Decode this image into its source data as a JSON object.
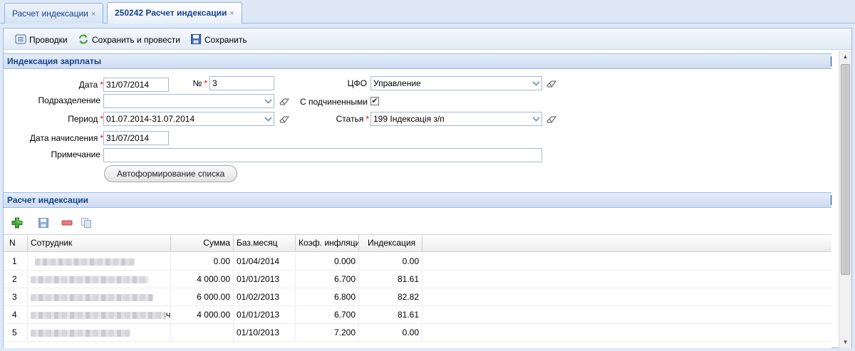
{
  "tabs": [
    {
      "label": "Расчет индексации",
      "close": "×"
    },
    {
      "label": "250242 Расчет индексации",
      "close": "×"
    }
  ],
  "toolbar": {
    "entries_label": "Проводки",
    "save_and_post_label": "Сохранить и провести",
    "save_label": "Сохранить"
  },
  "form": {
    "section_title": "Индексация зарплаты",
    "date": {
      "label": "Дата",
      "value": "31/07/2014"
    },
    "number": {
      "label": "№",
      "value": "3"
    },
    "cfo": {
      "label": "ЦФО",
      "value": "Управление"
    },
    "department": {
      "label": "Подразделение",
      "value": ""
    },
    "with_subordinates": {
      "label": "С подчиненными",
      "checked": true,
      "mark": "✔"
    },
    "period": {
      "label": "Период",
      "value": "01.07.2014-31.07.2014"
    },
    "article": {
      "label": "Статья",
      "value": "199 Індексація з/п"
    },
    "accrual_date": {
      "label": "Дата начисления",
      "value": "31/07/2014"
    },
    "note": {
      "label": "Примечание",
      "value": ""
    },
    "autofill_button": "Автоформирование списка",
    "required_mark": "*"
  },
  "grid": {
    "section_title": "Расчет индексации",
    "columns": [
      "N",
      "Сотрудник",
      "Сумма",
      "Баз.месяц",
      "Коэф. инфляции",
      "Индексация"
    ],
    "rows": [
      {
        "n": "1",
        "employee_tail": "",
        "sum": "0.00",
        "base_month": "01/04/2014",
        "coef": "0.000",
        "indexation": "0.00"
      },
      {
        "n": "2",
        "employee_tail": "",
        "sum": "4 000.00",
        "base_month": "01/01/2013",
        "coef": "6.700",
        "indexation": "81.61"
      },
      {
        "n": "3",
        "employee_tail": "",
        "sum": "6 000.00",
        "base_month": "01/02/2013",
        "coef": "6.800",
        "indexation": "82.82"
      },
      {
        "n": "4",
        "employee_tail": "ч",
        "sum": "4 000.00",
        "base_month": "01/01/2013",
        "coef": "6.700",
        "indexation": "81.61"
      },
      {
        "n": "5",
        "employee_tail": "",
        "sum": "",
        "base_month": "01/10/2013",
        "coef": "7.200",
        "indexation": "0.00"
      }
    ]
  },
  "colors": {
    "accent": "#15428b",
    "border": "#99bbe8",
    "required": "#ee0000"
  }
}
